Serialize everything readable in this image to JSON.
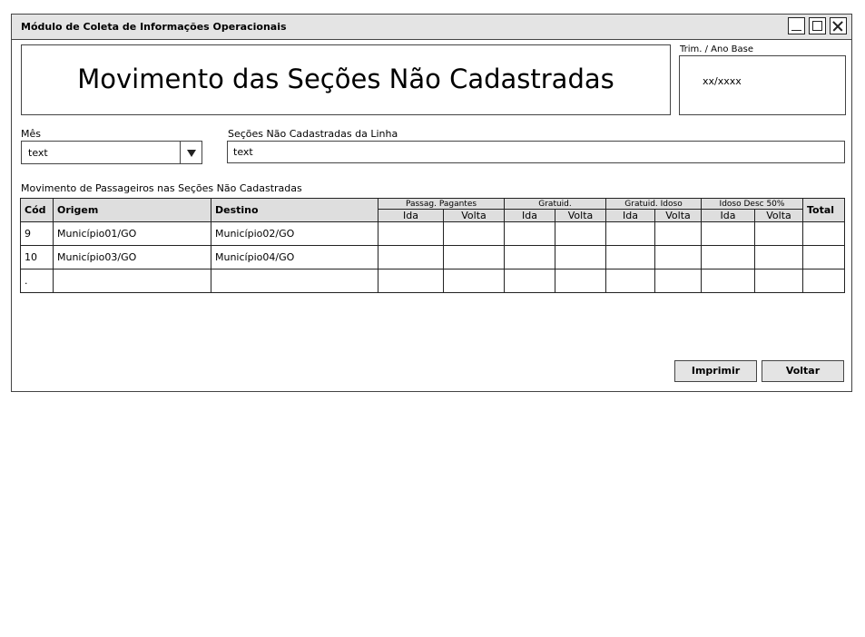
{
  "window": {
    "title": "Módulo de Coleta de Informações Operacionais"
  },
  "header": {
    "title": "Movimento das Seções Não Cadastradas"
  },
  "trim": {
    "label": "Trim. / Ano Base",
    "value": "xx/xxxx"
  },
  "mes": {
    "label": "Mês",
    "value": "text"
  },
  "secoes": {
    "label": "Seções Não Cadastradas da Linha",
    "value": "text"
  },
  "table": {
    "caption": "Movimento de Passageiros nas Seções Não Cadastradas",
    "headers": {
      "cod": "Cód",
      "origem": "Origem",
      "destino": "Destino",
      "total": "Total"
    },
    "groups": [
      "Passag. Pagantes",
      "Gratuid.",
      "Gratuid. Idoso",
      "Idoso Desc 50%"
    ],
    "sub": {
      "ida": "Ida",
      "volta": "Volta"
    },
    "rows": [
      {
        "cod": "9",
        "origem": "Município01/GO",
        "destino": "Município02/GO"
      },
      {
        "cod": "10",
        "origem": "Município03/GO",
        "destino": "Município04/GO"
      },
      {
        "cod": ".",
        "origem": "",
        "destino": ""
      }
    ]
  },
  "buttons": {
    "print": "Imprimir",
    "back": "Voltar"
  }
}
